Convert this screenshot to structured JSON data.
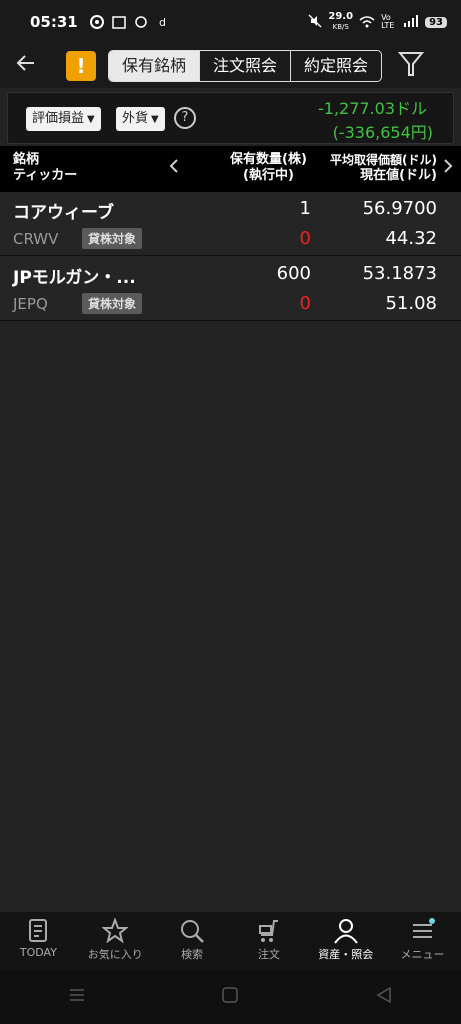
{
  "status": {
    "time": "05:31",
    "speed": "29.0",
    "speed_unit": "KB/S",
    "volte": "Vo LTE",
    "battery": "93"
  },
  "nav": {
    "warning": "!",
    "segments": [
      "保有銘柄",
      "注文照会",
      "約定照会"
    ]
  },
  "summary": {
    "dropdown1": "評価損益",
    "dropdown2": "外貨",
    "help": "?",
    "pl_foreign": "-1,277.03ドル",
    "pl_yen": "(-336,654円)"
  },
  "header": {
    "col1_line1": "銘柄",
    "col1_line2": "ティッカー",
    "col2_line1": "保有数量(株)",
    "col2_line2": "(執行中)",
    "col3_line1": "平均取得価額(ドル)",
    "col3_line2": "現在値(ドル)"
  },
  "holdings": [
    {
      "name": "コアウィーブ",
      "ticker": "CRWV",
      "badge": "貸株対象",
      "qty": "1",
      "pending": "0",
      "avg": "56.9700",
      "current": "44.32"
    },
    {
      "name": "JPモルガン・...",
      "ticker": "JEPQ",
      "badge": "貸株対象",
      "qty": "600",
      "pending": "0",
      "avg": "53.1873",
      "current": "51.08"
    }
  ],
  "tabs": [
    {
      "label": "TODAY",
      "icon": "document-icon"
    },
    {
      "label": "お気に入り",
      "icon": "star-icon"
    },
    {
      "label": "検索",
      "icon": "search-icon"
    },
    {
      "label": "注文",
      "icon": "cart-icon"
    },
    {
      "label": "資産・照会",
      "icon": "person-icon",
      "active": true
    },
    {
      "label": "メニュー",
      "icon": "menu-icon"
    }
  ],
  "colors": {
    "profit_loss": "#41c241",
    "pending": "#ee2222",
    "warning": "#f0a000"
  }
}
